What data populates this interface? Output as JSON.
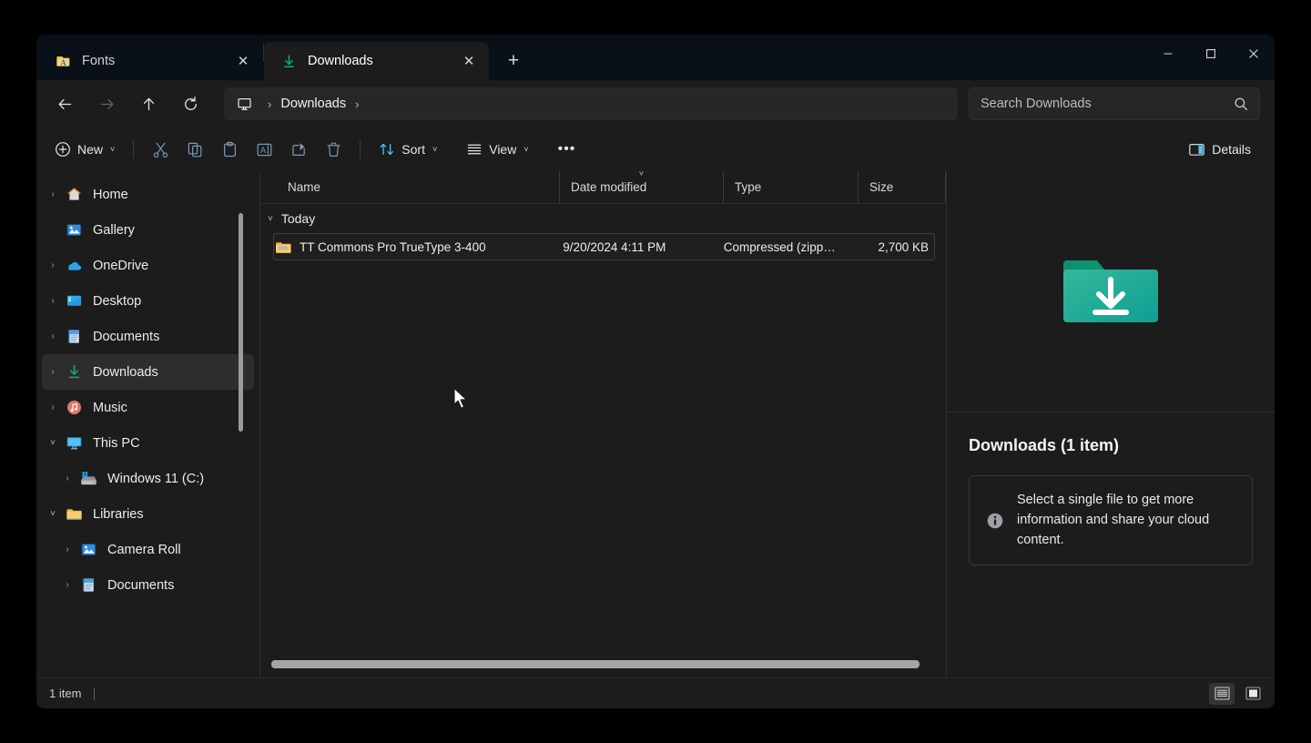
{
  "window": {
    "controls": {
      "minimize": "─",
      "maximize": "□",
      "close": "✕"
    }
  },
  "tabs": {
    "new_tab_label": "+",
    "items": [
      {
        "label": "Fonts",
        "icon": "fonts-folder-icon",
        "active": false,
        "close": "✕"
      },
      {
        "label": "Downloads",
        "icon": "download-arrow-icon",
        "active": true,
        "close": "✕"
      }
    ]
  },
  "address": {
    "back": "back-arrow",
    "forward": "forward-arrow",
    "up": "up-arrow",
    "refresh": "refresh",
    "root_icon": "this-pc-icon",
    "separator": "›",
    "crumb": "Downloads",
    "trailing_separator": "›"
  },
  "search": {
    "placeholder": "Search Downloads",
    "value": "Search Downloads",
    "icon": "search-icon"
  },
  "toolbar": {
    "new_label": "New",
    "new_chevron": "˅",
    "cut_label": "Cut",
    "copy_label": "Copy",
    "paste_label": "Paste",
    "rename_label": "Rename",
    "share_label": "Share",
    "delete_label": "Delete",
    "sort_label": "Sort",
    "sort_chevron": "˅",
    "view_label": "View",
    "view_chevron": "˅",
    "more_label": "•••",
    "details_label": "Details"
  },
  "sidebar": {
    "items": [
      {
        "label": "Home",
        "icon": "home-icon",
        "chevron": "›",
        "expanded": false,
        "indent": false,
        "selected": false
      },
      {
        "label": "Gallery",
        "icon": "gallery-icon",
        "chevron": "",
        "expanded": false,
        "indent": false,
        "selected": false
      },
      {
        "label": "OneDrive",
        "icon": "onedrive-icon",
        "chevron": "›",
        "expanded": false,
        "indent": false,
        "selected": false
      },
      {
        "label": "Desktop",
        "icon": "desktop-icon",
        "chevron": "›",
        "expanded": false,
        "indent": false,
        "selected": false
      },
      {
        "label": "Documents",
        "icon": "documents-icon",
        "chevron": "›",
        "expanded": false,
        "indent": false,
        "selected": false
      },
      {
        "label": "Downloads",
        "icon": "downloads-icon",
        "chevron": "›",
        "expanded": false,
        "indent": false,
        "selected": true
      },
      {
        "label": "Music",
        "icon": "music-icon",
        "chevron": "›",
        "expanded": false,
        "indent": false,
        "selected": false
      },
      {
        "label": "This PC",
        "icon": "thispc-icon",
        "chevron": "˅",
        "expanded": true,
        "indent": false,
        "selected": false
      },
      {
        "label": "Windows 11 (C:)",
        "icon": "drive-icon",
        "chevron": "›",
        "expanded": false,
        "indent": true,
        "selected": false
      },
      {
        "label": "Libraries",
        "icon": "libraries-icon",
        "chevron": "˅",
        "expanded": true,
        "indent": false,
        "selected": false
      },
      {
        "label": "Camera Roll",
        "icon": "camera-roll-icon",
        "chevron": "›",
        "expanded": false,
        "indent": true,
        "selected": false
      },
      {
        "label": "Documents",
        "icon": "documents-icon",
        "chevron": "›",
        "expanded": false,
        "indent": true,
        "selected": false
      }
    ]
  },
  "filelist": {
    "columns": [
      {
        "label": "Name",
        "sorted": false,
        "sort_glyph": ""
      },
      {
        "label": "Date modified",
        "sorted": true,
        "sort_glyph": "˅"
      },
      {
        "label": "Type",
        "sorted": false,
        "sort_glyph": ""
      },
      {
        "label": "Size",
        "sorted": false,
        "sort_glyph": ""
      }
    ],
    "groups": [
      {
        "label": "Today",
        "chevron": "˅",
        "rows": [
          {
            "name": "TT Commons Pro TrueType 3-400",
            "date_modified": "9/20/2024 4:11 PM",
            "type": "Compressed (zipp…",
            "size": "2,700 KB",
            "icon": "zip-folder-icon"
          }
        ]
      }
    ]
  },
  "details": {
    "preview_icon": "downloads-folder-large-icon",
    "title": "Downloads (1 item)",
    "info_icon": "info-icon",
    "info_text": "Select a single file to get more information and share your cloud content."
  },
  "statusbar": {
    "item_count": "1 item",
    "details_view_icon": "details-view-icon",
    "large_icons_view_icon": "large-icons-view-icon"
  },
  "colors": {
    "window_bg": "#1c1c1c",
    "titlebar_bg": "#0a1017",
    "accent": "#4cc2ff",
    "downloads_green": "#12a87a",
    "selected_row": "#2d2d2d"
  }
}
